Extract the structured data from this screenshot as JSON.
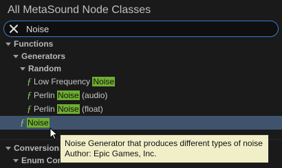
{
  "window": {
    "title": "All MetaSound Node Classes"
  },
  "search": {
    "value": "Noise",
    "clear_icon": "close-icon"
  },
  "tree": {
    "functions_label": "Functions",
    "generators_label": "Generators",
    "random_label": "Random",
    "items": [
      {
        "prefix": "Low Frequency ",
        "match": "Noise",
        "suffix": ""
      },
      {
        "prefix": "Perlin ",
        "match": "Noise",
        "suffix": " (audio)"
      },
      {
        "prefix": "Perlin ",
        "match": "Noise",
        "suffix": " (float)"
      }
    ],
    "selected": {
      "prefix": "",
      "match": "Noise",
      "suffix": ""
    },
    "conversions_label": "Conversions",
    "enum_label": "Enum Cor",
    "function_glyph": "ƒ"
  },
  "tooltip": {
    "line1": "Noise Generator that produces different types of noise",
    "line2": "Author: Epic Games, Inc."
  },
  "colors": {
    "highlight": "#6fae30",
    "selection": "#3f536d",
    "tooltip_bg": "#f1efc8",
    "focus_border": "#3a7fd0"
  }
}
